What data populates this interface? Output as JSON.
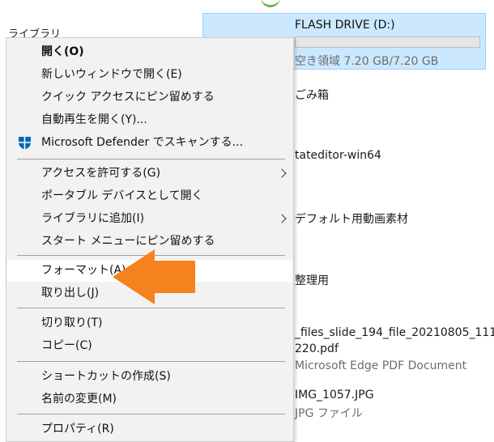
{
  "explorer": {
    "left_label": "ライブラリ",
    "drive": {
      "name": "FLASH DRIVE (D:)",
      "free_space": "空き領域 7.20 GB/7.20 GB",
      "used_fraction": 0.0
    },
    "items": [
      {
        "text": "ごみ箱"
      },
      {
        "text": "tateditor-win64"
      },
      {
        "text": "デフォルト用動画素材"
      },
      {
        "text": "整理用"
      },
      {
        "text": "_files_slide_194_file_20210805_111"
      },
      {
        "text": "220.pdf"
      },
      {
        "text": "Microsoft Edge PDF Document"
      },
      {
        "text": "IMG_1057.JPG"
      },
      {
        "text": "JPG ファイル"
      }
    ]
  },
  "menu": {
    "items": [
      {
        "label": "開く(O)",
        "bold": true
      },
      {
        "label": "新しいウィンドウで開く(E)"
      },
      {
        "label": "クイック アクセスにピン留めする"
      },
      {
        "label": "自動再生を開く(Y)..."
      },
      {
        "label": "Microsoft Defender でスキャンする...",
        "icon": "defender-shield-icon"
      },
      {
        "label": "アクセスを許可する(G)",
        "submenu": true
      },
      {
        "label": "ポータブル デバイスとして開く"
      },
      {
        "label": "ライブラリに追加(I)",
        "submenu": true
      },
      {
        "label": "スタート メニューにピン留めする"
      },
      {
        "label": "フォーマット(A)...",
        "highlighted": true
      },
      {
        "label": "取り出し(J)"
      },
      {
        "label": "切り取り(T)"
      },
      {
        "label": "コピー(C)"
      },
      {
        "label": "ショートカットの作成(S)"
      },
      {
        "label": "名前の変更(M)"
      },
      {
        "label": "プロパティ(R)"
      }
    ]
  },
  "colors": {
    "selection_bg": "#cce8ff",
    "arrow": "#f5821f",
    "defender_blue": "#0067b8"
  }
}
